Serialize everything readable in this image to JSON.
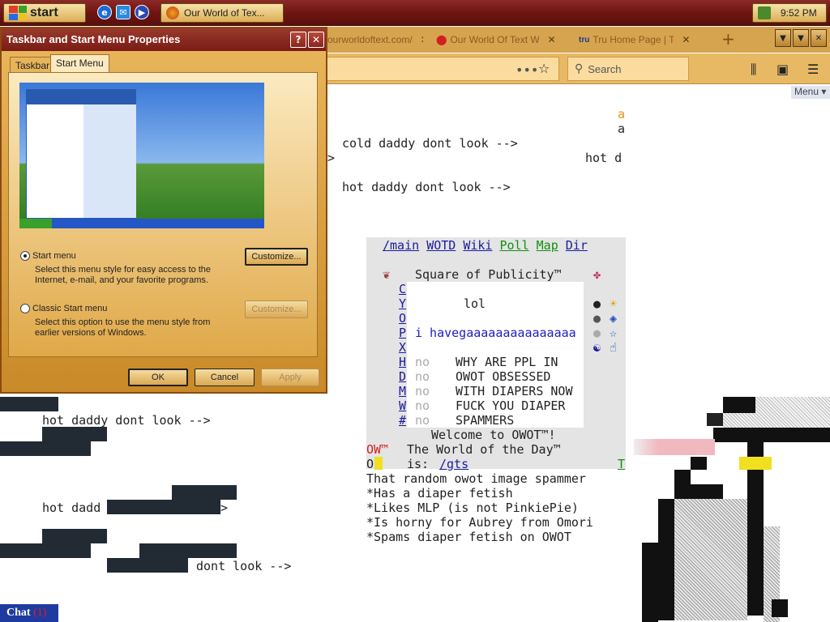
{
  "taskbar": {
    "start_label": "start",
    "task_label": "Our World of Tex...",
    "clock": "9:52 PM"
  },
  "browser": {
    "tabs": [
      {
        "label": "ourworldoftext.com/"
      },
      {
        "label": "Our World Of Text Wi..."
      },
      {
        "label": "Tru Home Page | TruTV"
      }
    ],
    "search_placeholder": "Search",
    "menu_label": "Menu ▾"
  },
  "dialog": {
    "title": "Taskbar and Start Menu Properties",
    "tabs": [
      "Taskbar",
      "Start Menu"
    ],
    "option_start": {
      "label": "Start menu",
      "desc_1": "Select this menu style for easy access to the",
      "desc_2": "Internet, e-mail, and your favorite programs.",
      "button": "Customize..."
    },
    "option_classic": {
      "label": "Classic Start menu",
      "desc_1": "Select this option to use the menu style from",
      "desc_2": "earlier versions of Windows.",
      "button": "Customize..."
    },
    "ok": "OK",
    "cancel": "Cancel",
    "apply": "Apply"
  },
  "owot": {
    "line_a1": "a",
    "line_a2": "a",
    "cold_line": "cold daddy dont look -->",
    "arrow_only": ">",
    "hot_d_right": "hot d",
    "hot_line_1": "hot daddy dont look -->",
    "hot_line_2": "hot daddy dont look -->",
    "hot_dadd": "hot dadd",
    "gt": ">",
    "dont_look": "dont look -->",
    "nav_links": [
      "/main",
      "WOTD",
      "Wiki",
      "Poll",
      "Map",
      "Dir"
    ],
    "square_title": "Square of Publicity™",
    "lol": "lol",
    "left_letters": [
      "C",
      "Y",
      "O",
      "P",
      "X",
      "H",
      "D",
      "M",
      "W",
      "#"
    ],
    "i_have": "i havegaaaaaaaaaaaaaaa",
    "no": "no",
    "shout_lines": [
      "WHY ARE PPL IN",
      "OWOT OBSESSED",
      "WITH DIAPERS NOW",
      "FUCK YOU DIAPER",
      "SPAMMERS"
    ],
    "welcome": "Welcome to OWOT™!",
    "ow_tm": "OW™",
    "world_of_day": "The World of the Day™",
    "o_char": "O",
    "is_label": "is:",
    "gts_link": "/gts",
    "t_char": "T",
    "desc_lines": [
      "That random owot image spammer",
      "*Has a diaper fetish",
      "*Likes MLP (is not PinkiePie)",
      "*Is horny for Aubrey from Omori",
      "*Spams diaper fetish on OWOT"
    ]
  },
  "chat": {
    "label": "Chat",
    "count": "(1)"
  }
}
